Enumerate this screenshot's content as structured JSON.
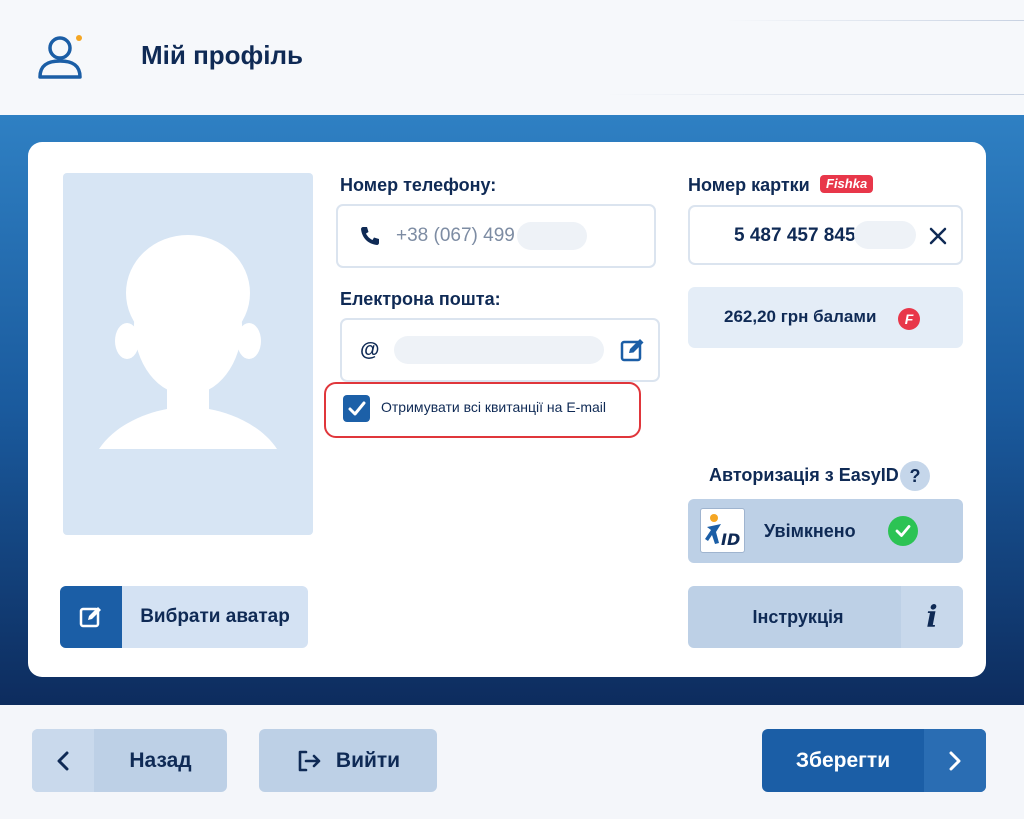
{
  "header": {
    "title": "Мій профіль",
    "icon": "user-profile-icon",
    "accent_color": "#f5a623"
  },
  "avatar": {
    "placeholder_icon": "person-silhouette-icon",
    "choose_button_label": "Вибрати аватар"
  },
  "phone": {
    "label": "Номер телефону:",
    "value": "+38 (067) 499",
    "icon": "phone-icon"
  },
  "email": {
    "label": "Електрона пошта:",
    "prefix": "@",
    "icon": "edit-icon"
  },
  "receipts_checkbox": {
    "label": "Отримувати всі квитанції на E-mail",
    "checked": true
  },
  "loyalty": {
    "label": "Номер картки",
    "badge": "Fishka",
    "card_number": "5 487 457 845",
    "points_text": "262,20 грн балами",
    "points_icon_letter": "F",
    "brand_color": "#e8374a"
  },
  "easyid": {
    "label": "Авторизація з EasyID",
    "help_symbol": "?",
    "logo_text": "ID",
    "status": "Увімкнено",
    "instruction_label": "Інструкція",
    "info_symbol": "i"
  },
  "footer": {
    "back_label": "Назад",
    "exit_label": "Вийти",
    "save_label": "Зберегти"
  },
  "colors": {
    "primary": "#1b5ea6",
    "text_dark": "#0f2a55",
    "highlight": "#e0363b",
    "success": "#2cc354"
  }
}
